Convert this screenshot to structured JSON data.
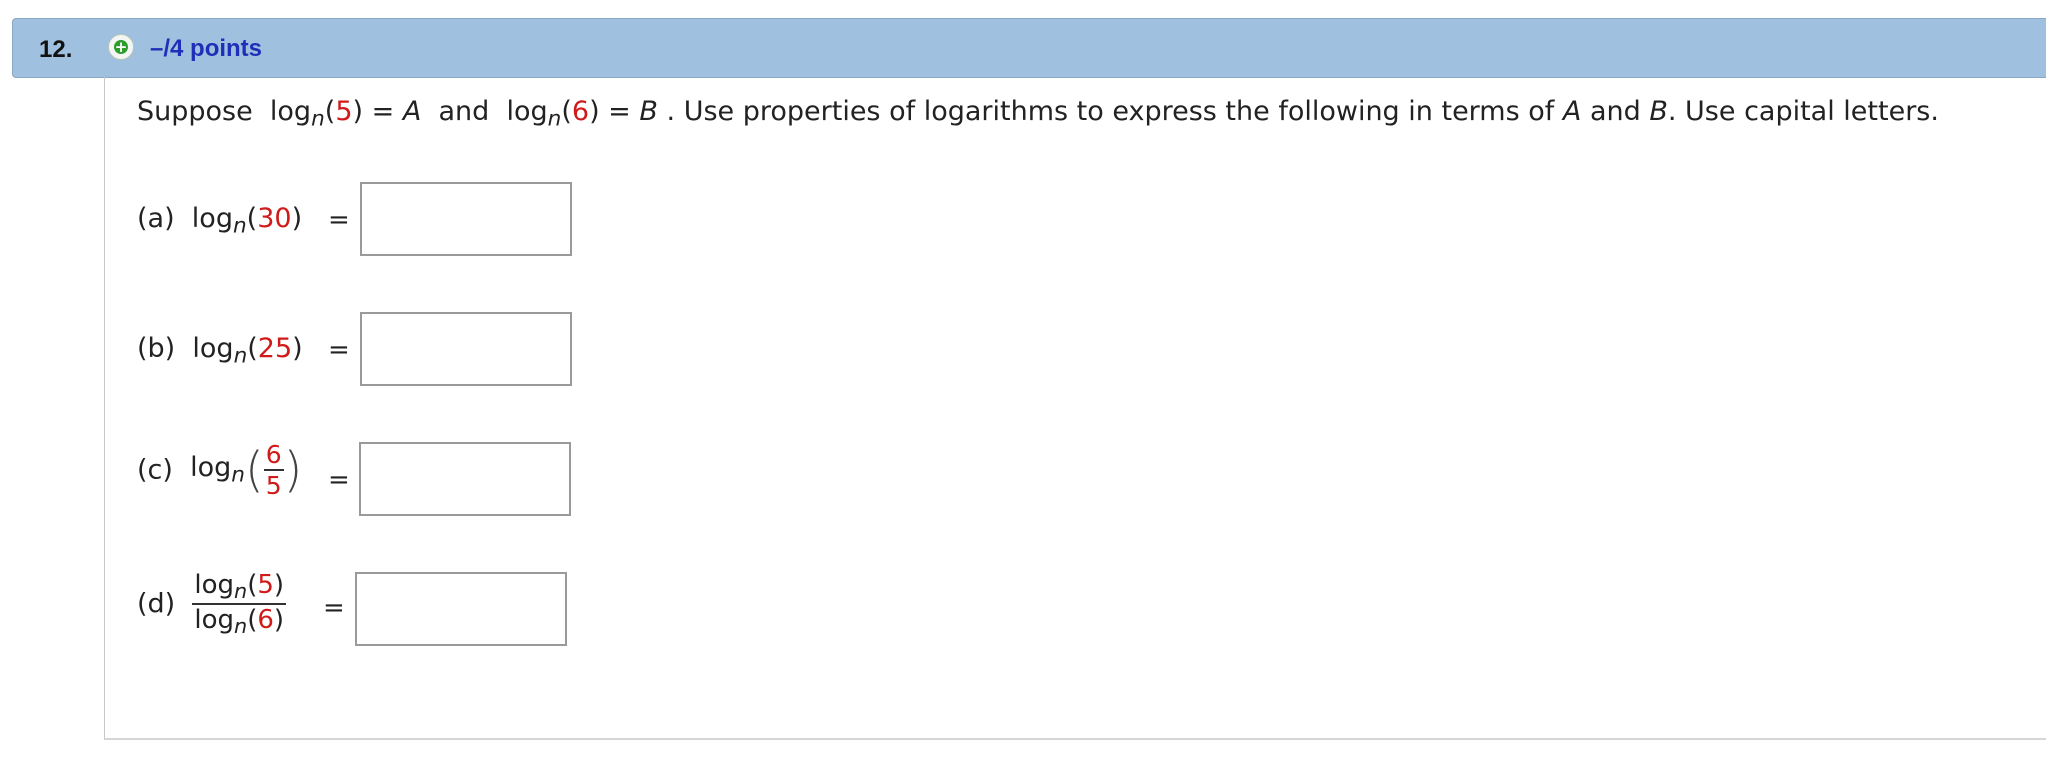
{
  "question": {
    "number": "12.",
    "points": "–/4 points"
  },
  "problem": {
    "pre1": "Suppose",
    "log": "log",
    "sub": "n",
    "lp": "(",
    "arg1": "5",
    "rp_eq": ") =",
    "var_a": "A",
    "and": "and",
    "arg2": "6",
    "var_b": "B",
    "rest1": ". Use properties of logarithms to express the following in terms of",
    "rest_a": "A",
    "rest_and": "and",
    "rest_b": "B",
    "rest2": ". Use capital letters."
  },
  "parts": [
    {
      "label": "(a)",
      "arg": "30",
      "equals": "="
    },
    {
      "label": "(b)",
      "arg": "25",
      "equals": "="
    },
    {
      "label": "(c)",
      "num": "6",
      "den": "5",
      "equals": "="
    },
    {
      "label": "(d)",
      "num_arg": "5",
      "den_arg": "6",
      "equals": "="
    }
  ],
  "answers": [
    "",
    "",
    "",
    ""
  ]
}
